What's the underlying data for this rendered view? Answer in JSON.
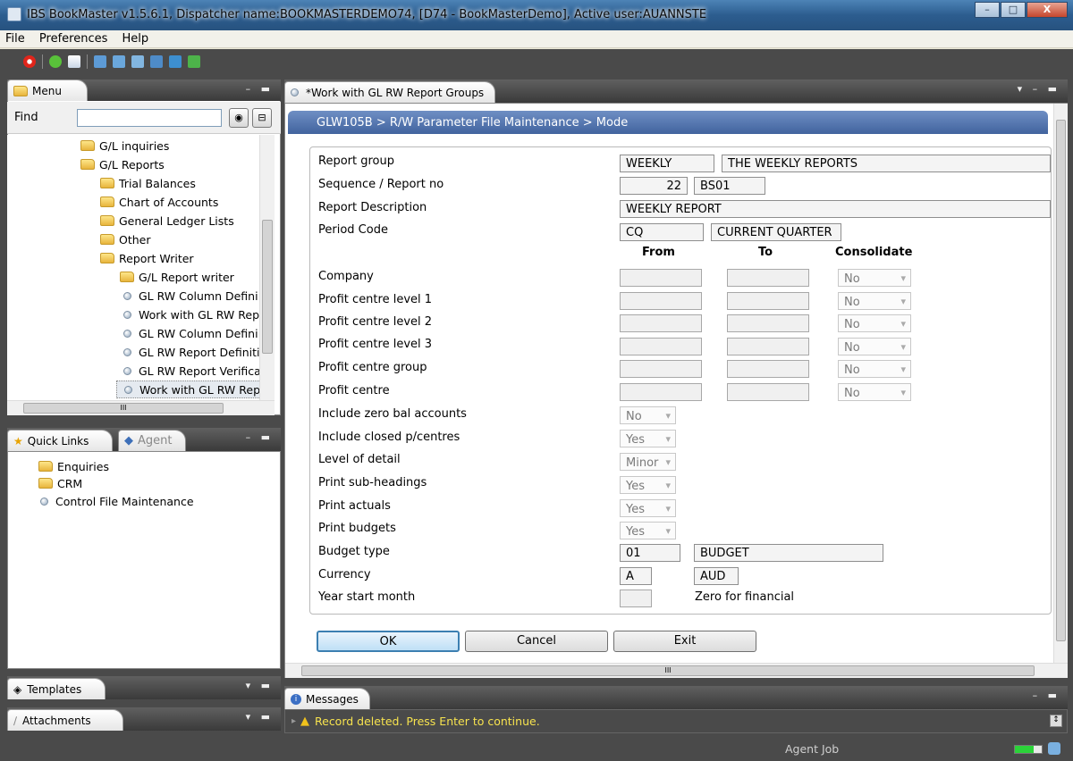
{
  "window": {
    "title": "IBS BookMaster v1.5.6.1, Dispatcher name:BOOKMASTERDEMO74,  [D74 - BookMasterDemo], Active user:AUANNSTE",
    "min_label": "–",
    "max_label": "□",
    "close_label": "X"
  },
  "menubar": [
    "File",
    "Preferences",
    "Help"
  ],
  "menu_panel": {
    "tab_label": "Menu",
    "find_label": "Find",
    "find_value": "",
    "tree": [
      {
        "label": "G/L inquiries",
        "type": "folder",
        "level": 1
      },
      {
        "label": "G/L Reports",
        "type": "folder",
        "level": 1
      },
      {
        "label": "Trial Balances",
        "type": "folder",
        "level": 2
      },
      {
        "label": "Chart of Accounts",
        "type": "folder",
        "level": 2
      },
      {
        "label": "General Ledger Lists",
        "type": "folder",
        "level": 2
      },
      {
        "label": "Other",
        "type": "folder",
        "level": 2
      },
      {
        "label": "Report Writer",
        "type": "folder",
        "level": 2
      },
      {
        "label": "G/L Report writer",
        "type": "folder",
        "level": 3
      },
      {
        "label": "GL RW Column Defini",
        "type": "item",
        "level": 3
      },
      {
        "label": "Work with GL RW Rep",
        "type": "item",
        "level": 3
      },
      {
        "label": "GL RW Column Defini",
        "type": "item",
        "level": 3
      },
      {
        "label": "GL RW Report Definiti",
        "type": "item",
        "level": 3
      },
      {
        "label": "GL RW Report Verifica",
        "type": "item",
        "level": 3
      },
      {
        "label": "Work with GL RW Rep",
        "type": "item",
        "level": 3,
        "selected": true
      }
    ],
    "hscroll_label": "III"
  },
  "quick_links": {
    "tab_label": "Quick Links",
    "agent_tab_label": "Agent",
    "items": [
      {
        "label": "Enquiries",
        "type": "folder"
      },
      {
        "label": "CRM",
        "type": "folder"
      },
      {
        "label": "Control File Maintenance",
        "type": "item"
      }
    ]
  },
  "templates_tab": "Templates",
  "attachments_tab": "Attachments",
  "main": {
    "tab_label": "*Work with GL RW Report Groups",
    "breadcrumb": "GLW105B > R/W Parameter File Maintenance > Mode",
    "hscroll_label": "III",
    "form": {
      "report_group_label": "Report group",
      "report_group_code": "WEEKLY",
      "report_group_desc": "THE WEEKLY REPORTS",
      "sequence_label": "Sequence / Report no",
      "sequence_no": "22",
      "report_no": "BS01",
      "report_desc_label": "Report Description",
      "report_desc": "WEEKLY REPORT",
      "period_code_label": "Period Code",
      "period_code": "CQ",
      "period_desc": "CURRENT QUARTER",
      "col_from": "From",
      "col_to": "To",
      "col_consolidate": "Consolidate",
      "range_rows": [
        {
          "label": "Company",
          "consolidate": "No"
        },
        {
          "label": "Profit centre level 1",
          "consolidate": "No"
        },
        {
          "label": "Profit centre level 2",
          "consolidate": "No"
        },
        {
          "label": "Profit centre level 3",
          "consolidate": "No"
        },
        {
          "label": "Profit centre group",
          "consolidate": "No"
        },
        {
          "label": "Profit centre",
          "consolidate": "No"
        }
      ],
      "option_rows": [
        {
          "label": "Include zero bal accounts",
          "value": "No"
        },
        {
          "label": "Include closed p/centres",
          "value": "Yes"
        },
        {
          "label": "Level of detail",
          "value": "Minor"
        },
        {
          "label": "Print sub-headings",
          "value": "Yes"
        },
        {
          "label": "Print actuals",
          "value": "Yes"
        },
        {
          "label": "Print budgets",
          "value": "Yes"
        }
      ],
      "budget_type_label": "Budget type",
      "budget_type_code": "01",
      "budget_type_desc": "BUDGET",
      "currency_label": "Currency",
      "currency_code": "A",
      "currency_desc": "AUD",
      "year_start_label": "Year start month",
      "year_start_value": "",
      "year_start_hint": "Zero for financial"
    },
    "buttons": {
      "ok": "OK",
      "cancel": "Cancel",
      "exit": "Exit"
    }
  },
  "messages": {
    "tab_label": "Messages",
    "text": "Record deleted. Press Enter to continue."
  },
  "status": {
    "agent_job": "Agent Job"
  }
}
